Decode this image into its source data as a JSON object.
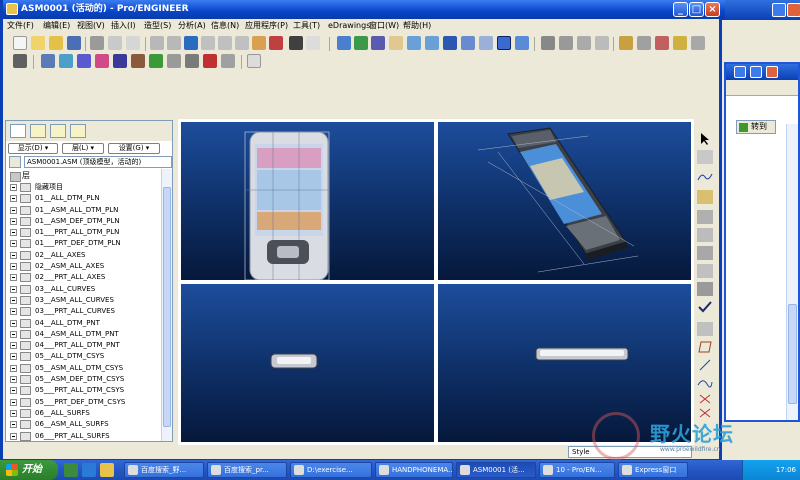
{
  "window": {
    "title": "ASM0001 (活动的) - Pro/ENGINEER"
  },
  "menu": [
    "文件(F)",
    "编辑(E)",
    "视图(V)",
    "插入(I)",
    "造型(S)",
    "分析(A)",
    "信息(N)",
    "应用程序(P)",
    "工具(T)",
    "eDrawings",
    "窗口(W)",
    "帮助(H)"
  ],
  "panel": {
    "show_button": "显示(D) ▾",
    "layer_button": "层(L) ▾",
    "settings_button": "设置(G) ▾",
    "assembly_label": "ASM0001.ASM (顶级模型，活动的)",
    "layer_header": "层",
    "tree_items": [
      "隐藏项目",
      "01__ALL_DTM_PLN",
      "01__ASM_ALL_DTM_PLN",
      "01__ASM_DEF_DTM_PLN",
      "01___PRT_ALL_DTM_PLN",
      "01___PRT_DEF_DTM_PLN",
      "02__ALL_AXES",
      "02__ASM_ALL_AXES",
      "02___PRT_ALL_AXES",
      "03__ALL_CURVES",
      "03__ASM_ALL_CURVES",
      "03___PRT_ALL_CURVES",
      "04__ALL_DTM_PNT",
      "04__ASM_ALL_DTM_PNT",
      "04___PRT_ALL_DTM_PNT",
      "05__ALL_DTM_CSYS",
      "05__ASM_ALL_DTM_CSYS",
      "05__ASM_DEF_DTM_CSYS",
      "05___PRT_ALL_DTM_CSYS",
      "05___PRT_DEF_DTM_CSYS",
      "06__ALL_SURFS",
      "06__ASM_ALL_SURFS",
      "06___PRT_ALL_SURFS"
    ]
  },
  "status": {
    "style_label": "Style"
  },
  "side_window": {
    "jump_button": "转到"
  },
  "watermark": {
    "text": "野火论坛",
    "url": "www.proewildfire.cn"
  },
  "taskbar": {
    "start": "开始",
    "tasks": [
      "百度搜索_野...",
      "百度搜索_pr...",
      "D:\\exercise...",
      "HANDPHONEMA...",
      "ASM0001 (活...",
      "10 - Pro/EN...",
      "Express窗口"
    ],
    "clock": "17:06"
  },
  "colors": {
    "titlebar": "#0845c9",
    "viewport_top": "#1d4d9c",
    "viewport_bottom": "#06183b"
  }
}
